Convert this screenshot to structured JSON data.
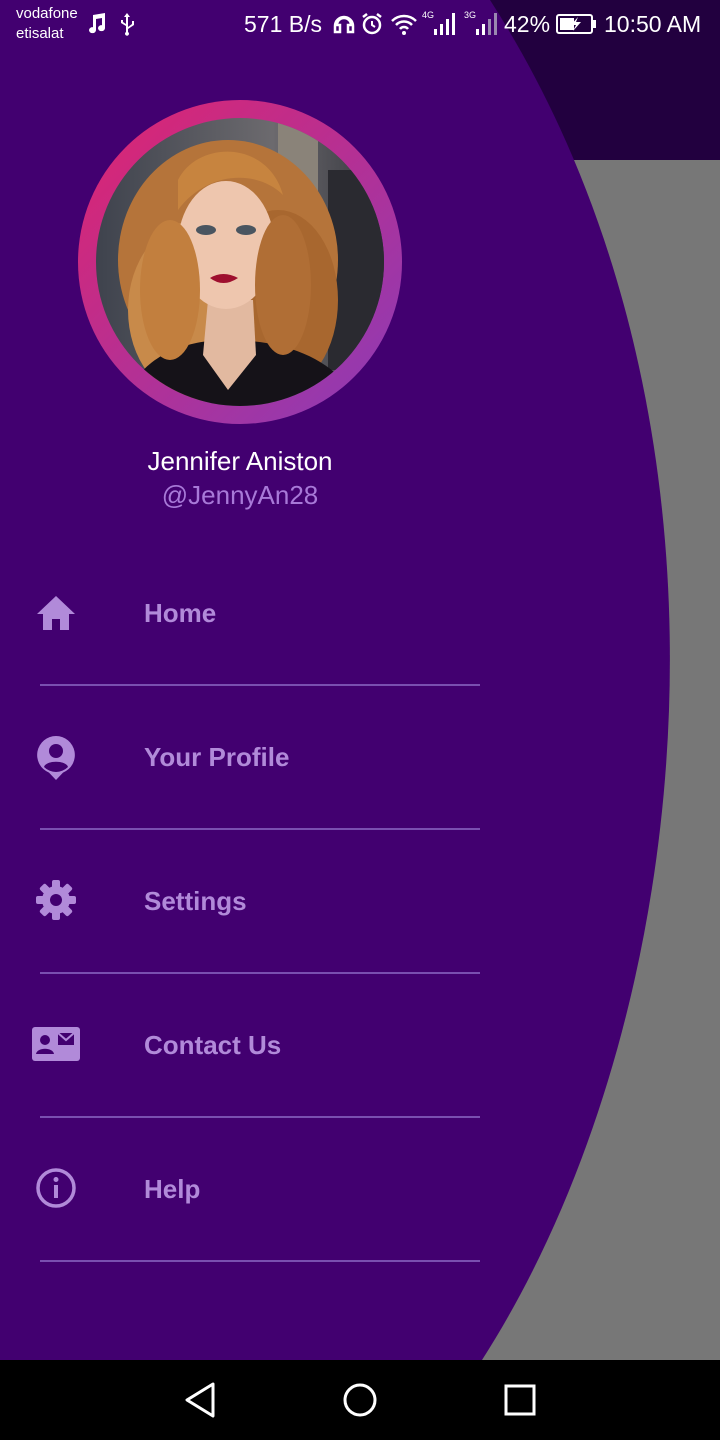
{
  "status_bar": {
    "carrier_line1": "vodafone",
    "carrier_line2": "etisalat",
    "net_speed": "571 B/s",
    "network_4g": "4G",
    "network_3g": "3G",
    "battery": "42%",
    "time": "10:50 AM",
    "icons": [
      "music-note-icon",
      "usb-icon",
      "headphones-icon",
      "alarm-icon",
      "wifi-icon",
      "signal-4g-icon",
      "signal-3g-icon",
      "battery-charging-icon"
    ]
  },
  "drawer": {
    "background_color": "#420070",
    "profile": {
      "name": "Jennifer Aniston",
      "handle": "@JennyAn28",
      "ring_gradient": [
        "#e0246f",
        "#8a3cb8"
      ]
    },
    "menu": [
      {
        "label": "Home",
        "icon": "home-icon"
      },
      {
        "label": "Your Profile",
        "icon": "profile-icon"
      },
      {
        "label": "Settings",
        "icon": "gear-icon"
      },
      {
        "label": "Contact Us",
        "icon": "contact-card-icon"
      },
      {
        "label": "Help",
        "icon": "info-icon"
      }
    ],
    "menu_color": "#b18ad9"
  },
  "nav_bar": {
    "buttons": [
      "back-triangle-icon",
      "home-circle-icon",
      "recents-square-icon"
    ]
  }
}
